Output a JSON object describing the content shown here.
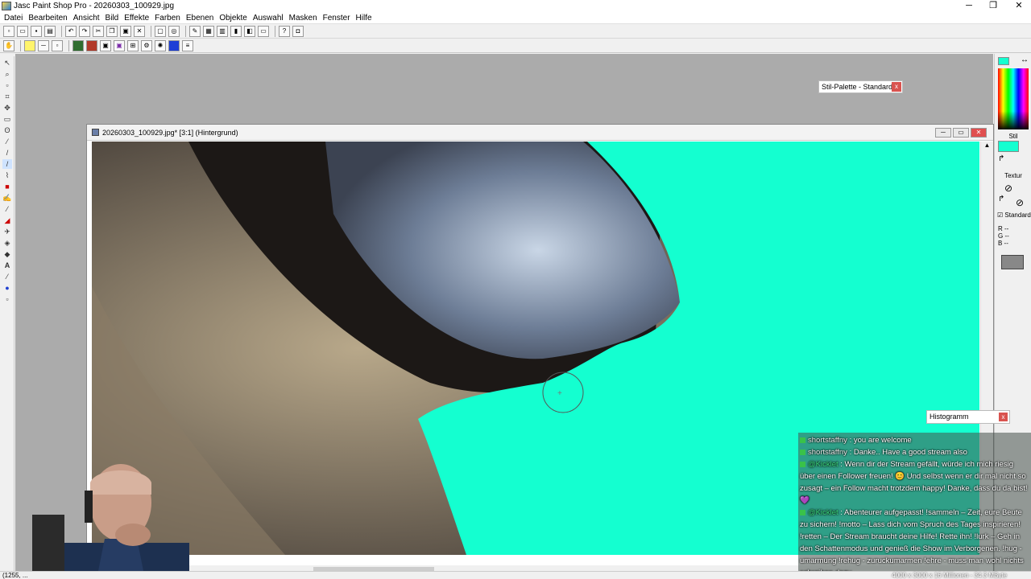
{
  "window": {
    "title": "Jasc Paint Shop Pro - 20260303_100929.jpg",
    "minimize": "─",
    "maximize": "❐",
    "close": "✕"
  },
  "menu": [
    "Datei",
    "Bearbeiten",
    "Ansicht",
    "Bild",
    "Effekte",
    "Farben",
    "Ebenen",
    "Objekte",
    "Auswahl",
    "Masken",
    "Fenster",
    "Hilfe"
  ],
  "stil_palette": {
    "title": "Stil-Palette - Standard...",
    "close": "x"
  },
  "image_window": {
    "title": "20260303_100929.jpg* [3:1] (Hintergrund)",
    "fill_color": "#14ffd0"
  },
  "right_panel": {
    "stil_label": "Stil",
    "textur_label": "Textur",
    "standard_label": "Standard",
    "rgb": [
      "R   --",
      "G   --",
      "B   --"
    ],
    "foreground_color": "#14ffd0"
  },
  "histogram": {
    "title": "Histogramm",
    "close": "x"
  },
  "chat": [
    {
      "user": "shortstaffny",
      "text": "you are welcome",
      "kicklet": false
    },
    {
      "user": "shortstaffny",
      "text": "Danke.. Have a good stream also",
      "kicklet": false
    },
    {
      "user": "@Kicklet",
      "text": "Wenn dir der Stream gefällt, würde ich mich riesig über einen Follower freuen! 😊 Und selbst wenn er dir mal nicht so zusagt – ein Follow macht trotzdem happy! Danke, dass du da bist! 💜",
      "kicklet": true
    },
    {
      "user": "@Kicklet",
      "text": "Abenteurer aufgepasst! !sammeln – Zeit, eure Beute zu sichern! !motto – Lass dich vom Spruch des Tages inspirieren! !retten – Der Stream braucht deine Hilfe! Rette ihn! !lurk – Geh in den Schattenmodus und genieß die Show im Verborgenen. !hug - umarmung !rehug - zuruckumarmen !ehre - muss man wohl nichts schreiben dazu",
      "kicklet": true
    }
  ],
  "status": {
    "left": "(1255, ...",
    "right": "4000 x 3000 x 16 Millionen - 34.3 MByte"
  }
}
